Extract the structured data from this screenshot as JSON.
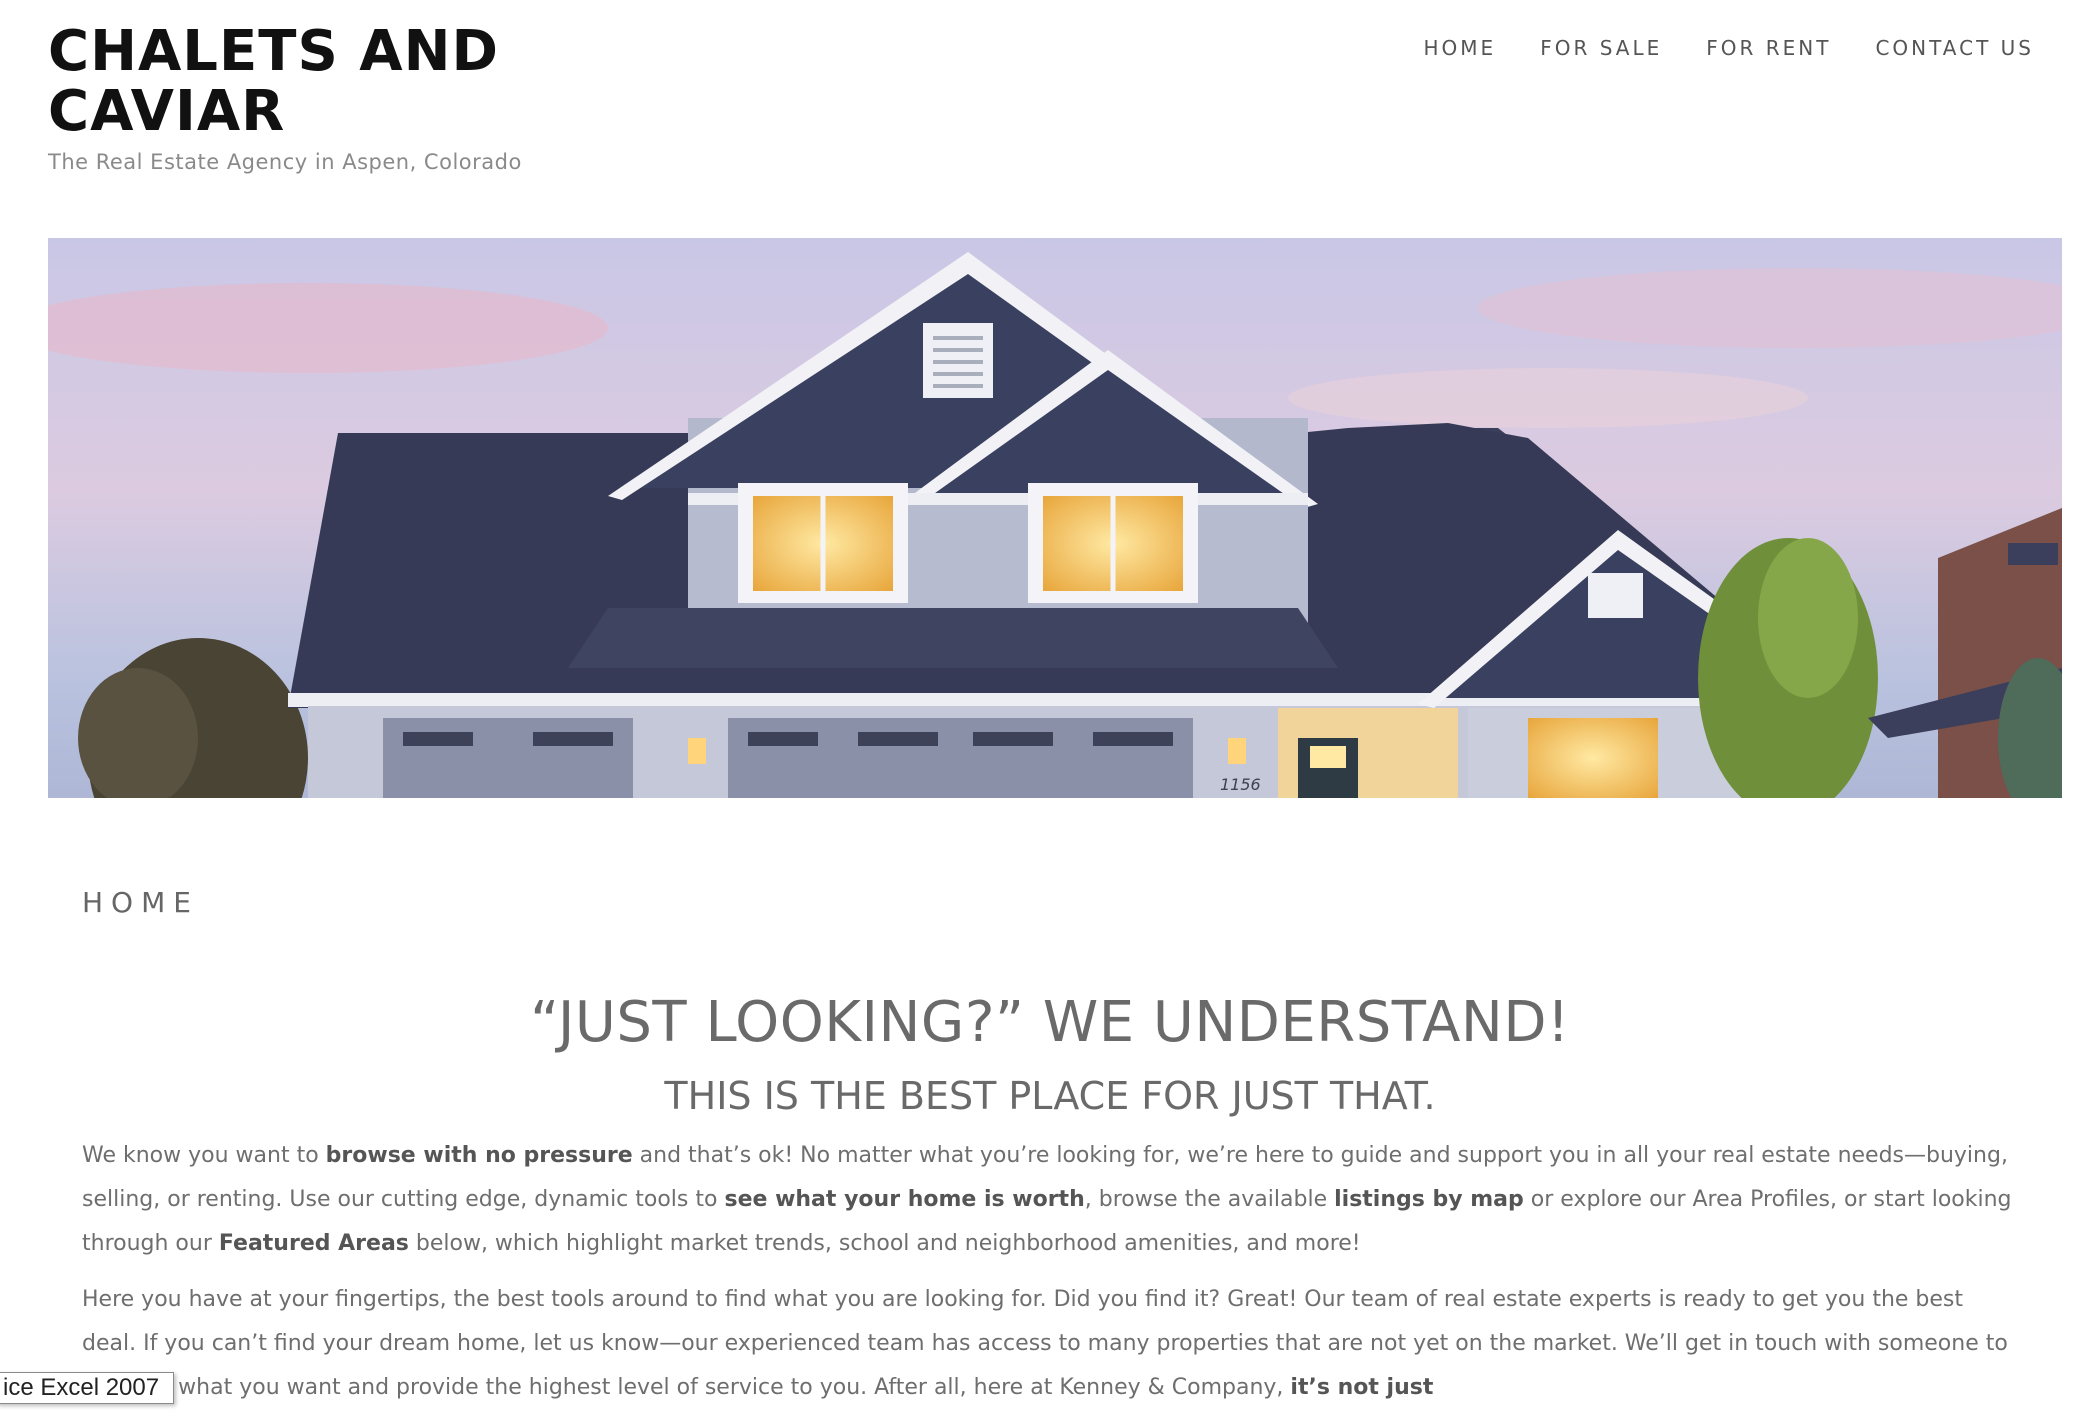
{
  "site": {
    "title": "CHALETS AND CAVIAR",
    "tagline": "The Real Estate Agency in Aspen, Colorado"
  },
  "nav": {
    "items": [
      {
        "label": "HOME"
      },
      {
        "label": "FOR SALE"
      },
      {
        "label": "FOR RENT"
      },
      {
        "label": "CONTACT US"
      }
    ]
  },
  "hero": {
    "house_number": "1156"
  },
  "page": {
    "heading": "HOME",
    "headline": "“JUST LOOKING?” WE UNDERSTAND!",
    "subheadline": "THIS IS THE BEST PLACE FOR JUST THAT.",
    "p1": {
      "t1": "We know you want to ",
      "b1": "browse with no pressure",
      "t2": " and that’s ok! No matter what you’re looking for, we’re here to guide and support you in all your real estate needs—buying, selling, or renting. Use our cutting edge, dynamic tools to ",
      "b2": "see what your home is worth",
      "t3": ", browse the available ",
      "b3": "listings by map",
      "t4": " or explore our Area Profiles, or start looking through our ",
      "b4": "Featured Areas",
      "t5": " below, which highlight market trends, school and neighborhood amenities, and more!"
    },
    "p2": {
      "t1": "Here you have at your fingertips, the best tools around to find what you are looking for. Did you find it? Great! Our team of real estate experts is ready to get you the best deal. If you can’t find your dream home, let us know—our experienced team has access to many properties that are not yet on the market. We’ll get in touch with someone to find you what you want and provide the highest level of service to you. After all, here at Kenney & Company, ",
      "b1": "it’s not just"
    }
  },
  "tooltip": {
    "text": "ice Excel 2007"
  },
  "colors": {
    "title": "#111111",
    "body_text": "#6e6e6e",
    "nav_text": "#555555",
    "roof": "#3b3f5c",
    "siding": "#b3b8cc",
    "window_glow": "#f6c35a"
  }
}
